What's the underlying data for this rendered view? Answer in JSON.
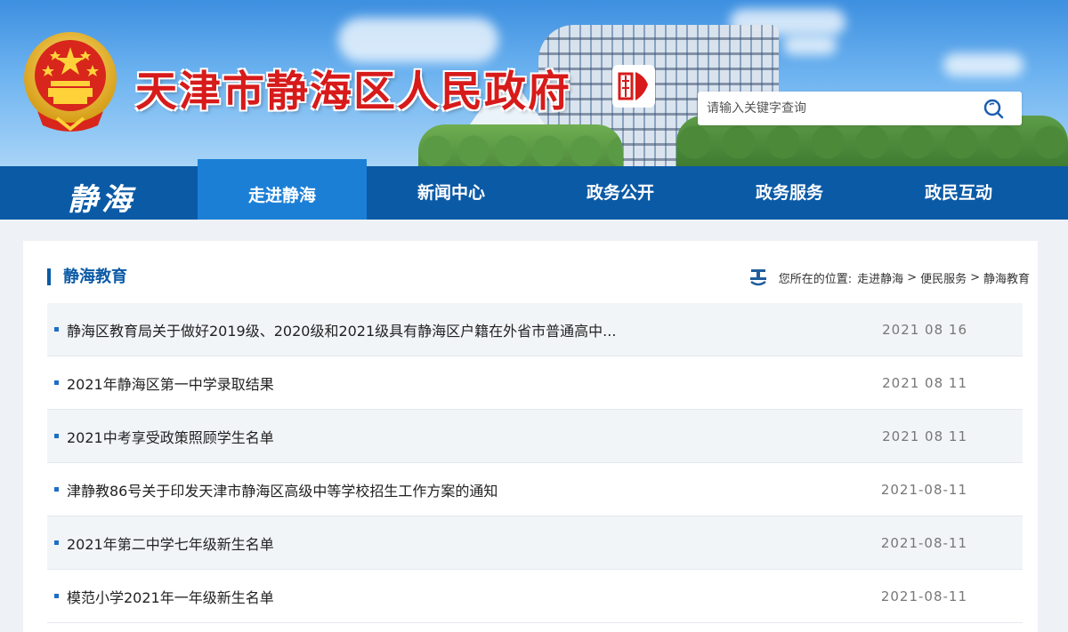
{
  "header": {
    "site_title": "天津市静海区人民政府",
    "emblem_icon": "national-emblem-icon",
    "seal_icon": "tianjin-seal-icon",
    "search": {
      "placeholder": "请输入关键字查询",
      "button_icon": "search-icon"
    }
  },
  "nav": {
    "logo_text": "静海",
    "items": [
      {
        "label": "走进静海",
        "active": true
      },
      {
        "label": "新闻中心",
        "active": false
      },
      {
        "label": "政务公开",
        "active": false
      },
      {
        "label": "政务服务",
        "active": false
      },
      {
        "label": "政民互动",
        "active": false
      }
    ]
  },
  "section": {
    "title": "静海教育",
    "breadcrumb_icon": "location-icon",
    "breadcrumb_prefix": "您所在的位置:",
    "breadcrumb": [
      "走进静海",
      "便民服务",
      "静海教育"
    ],
    "separator": ">"
  },
  "news": [
    {
      "title": "静海区教育局关于做好2019级、2020级和2021级具有静海区户籍在外省市普通高中...",
      "date": "2021 08 16"
    },
    {
      "title": "2021年静海区第一中学录取结果",
      "date": "2021 08 11"
    },
    {
      "title": "2021中考享受政策照顾学生名单",
      "date": "2021 08 11"
    },
    {
      "title": "津静教86号关于印发天津市静海区高级中等学校招生工作方案的通知",
      "date": "2021-08-11"
    },
    {
      "title": "2021年第二中学七年级新生名单",
      "date": "2021-08-11"
    },
    {
      "title": "模范小学2021年一年级新生名单",
      "date": "2021-08-11"
    }
  ],
  "colors": {
    "nav_bg": "#0b5aa6",
    "nav_active": "#1c7fd6",
    "title_red": "#d71a1a",
    "accent_blue": "#0b5aa6"
  }
}
